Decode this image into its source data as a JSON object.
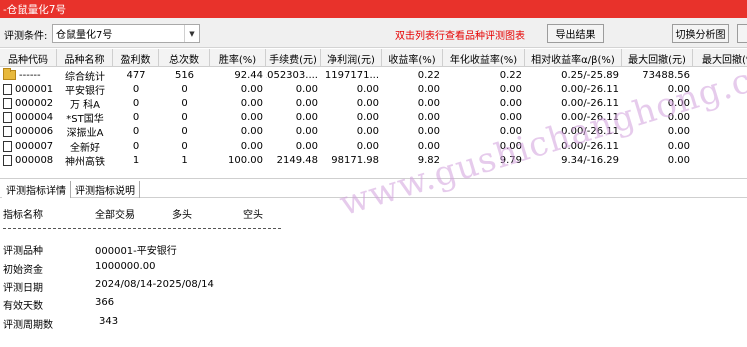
{
  "window": {
    "title": "-仓鼠量化7号"
  },
  "toolbar": {
    "label": "评测条件:",
    "select_value": "仓鼠量化7号",
    "hint": "双击列表行查看品种评测图表",
    "export_label": "导出结果",
    "switch_label": "切换分析图",
    "more_label": ""
  },
  "grid": {
    "columns": [
      "品种代码",
      "品种名称",
      "盈利数",
      "总次数",
      "胜率(%)",
      "手续费(元)",
      "净利润(元)",
      "收益率(%)",
      "年化收益率(%)",
      "相对收益率α/β(%)",
      "最大回撤(元)",
      "最大回撤(%)"
    ],
    "rows": [
      {
        "icon": "folder-icon",
        "code": "------",
        "name": "综合统计",
        "wins": "477",
        "total": "516",
        "winrate": "92.44",
        "fee": "1052303....",
        "profit": "1197171...",
        "ret": "0.22",
        "annual": "0.22",
        "relative": "0.25/-25.89",
        "maxdd": "73488.56",
        "maxddp": ""
      },
      {
        "icon": "doc-icon",
        "code": "000001",
        "name": "平安银行",
        "wins": "0",
        "total": "0",
        "winrate": "0.00",
        "fee": "0.00",
        "profit": "0.00",
        "ret": "0.00",
        "annual": "0.00",
        "relative": "0.00/-26.11",
        "maxdd": "0.00",
        "maxddp": ""
      },
      {
        "icon": "doc-icon",
        "code": "000002",
        "name": "万 科A",
        "wins": "0",
        "total": "0",
        "winrate": "0.00",
        "fee": "0.00",
        "profit": "0.00",
        "ret": "0.00",
        "annual": "0.00",
        "relative": "0.00/-26.11",
        "maxdd": "0.00",
        "maxddp": ""
      },
      {
        "icon": "doc-icon",
        "code": "000004",
        "name": "*ST国华",
        "wins": "0",
        "total": "0",
        "winrate": "0.00",
        "fee": "0.00",
        "profit": "0.00",
        "ret": "0.00",
        "annual": "0.00",
        "relative": "0.00/-26.11",
        "maxdd": "0.00",
        "maxddp": ""
      },
      {
        "icon": "doc-icon",
        "code": "000006",
        "name": "深振业A",
        "wins": "0",
        "total": "0",
        "winrate": "0.00",
        "fee": "0.00",
        "profit": "0.00",
        "ret": "0.00",
        "annual": "0.00",
        "relative": "0.00/-26.11",
        "maxdd": "0.00",
        "maxddp": ""
      },
      {
        "icon": "doc-icon",
        "code": "000007",
        "name": "全新好",
        "wins": "0",
        "total": "0",
        "winrate": "0.00",
        "fee": "0.00",
        "profit": "0.00",
        "ret": "0.00",
        "annual": "0.00",
        "relative": "0.00/-26.11",
        "maxdd": "0.00",
        "maxddp": ""
      },
      {
        "icon": "doc-icon",
        "code": "000008",
        "name": "神州高铁",
        "wins": "1",
        "total": "1",
        "winrate": "100.00",
        "fee": "2149.48",
        "profit": "98171.98",
        "ret": "9.82",
        "annual": "9.79",
        "relative": "9.34/-16.29",
        "maxdd": "0.00",
        "maxddp": ""
      }
    ]
  },
  "tabs": [
    {
      "label": "评测指标详情"
    },
    {
      "label": "评测指标说明"
    }
  ],
  "detail": {
    "header": {
      "name": "指标名称",
      "all": "全部交易",
      "long": "多头",
      "short": "空头"
    },
    "items": [
      {
        "label": "评测品种",
        "value": "000001-平安银行"
      },
      {
        "label": "初始资金",
        "value": "1000000.00"
      },
      {
        "label": "评测日期",
        "value": "2024/08/14-2025/08/14"
      },
      {
        "label": "有效天数",
        "value": "366"
      },
      {
        "label": "评测周期数",
        "value": "343"
      }
    ]
  },
  "watermark": {
    "text": "www.gushichanghong.com"
  },
  "colors": {
    "titlebar": "#e8322b",
    "hint": "#e60000",
    "watermark": "#d2a0dc"
  }
}
